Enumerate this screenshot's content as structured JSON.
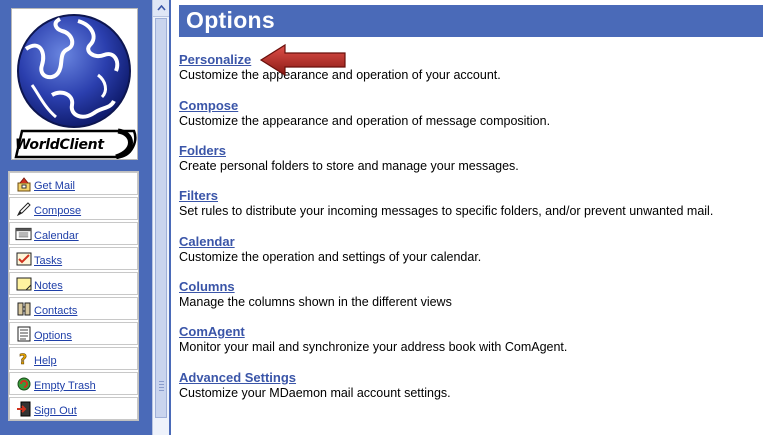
{
  "sidebar": {
    "logo_text": "WorldClient",
    "items": [
      {
        "label": "Get Mail",
        "icon": "mailbox-icon"
      },
      {
        "label": "Compose",
        "icon": "pen-icon"
      },
      {
        "label": "Calendar",
        "icon": "calendar-icon"
      },
      {
        "label": "Tasks",
        "icon": "checklist-icon"
      },
      {
        "label": "Notes",
        "icon": "note-icon"
      },
      {
        "label": "Contacts",
        "icon": "address-book-icon"
      },
      {
        "label": "Options",
        "icon": "options-notepad-icon"
      },
      {
        "label": "Help",
        "icon": "help-question-icon"
      },
      {
        "label": "Empty Trash",
        "icon": "trash-icon"
      },
      {
        "label": "Sign Out",
        "icon": "sign-out-door-icon"
      }
    ]
  },
  "page": {
    "title": "Options"
  },
  "options": [
    {
      "title": "Personalize",
      "desc": "Customize the appearance and operation of your account."
    },
    {
      "title": "Compose",
      "desc": "Customize the appearance and operation of message composition."
    },
    {
      "title": "Folders",
      "desc": "Create personal folders to store and manage your messages."
    },
    {
      "title": "Filters",
      "desc": "Set rules to distribute your incoming messages to specific folders, and/or prevent unwanted mail."
    },
    {
      "title": "Calendar",
      "desc": "Customize the operation and settings of your calendar."
    },
    {
      "title": "Columns",
      "desc": "Manage the columns shown in the different views"
    },
    {
      "title": "ComAgent",
      "desc": "Monitor your mail and synchronize your address book with ComAgent."
    },
    {
      "title": "Advanced Settings",
      "desc": "Customize your MDaemon mail account settings."
    }
  ],
  "colors": {
    "header_bg": "#4a6ab8",
    "link": "#3a55a8",
    "arrow": "#c0392b"
  }
}
